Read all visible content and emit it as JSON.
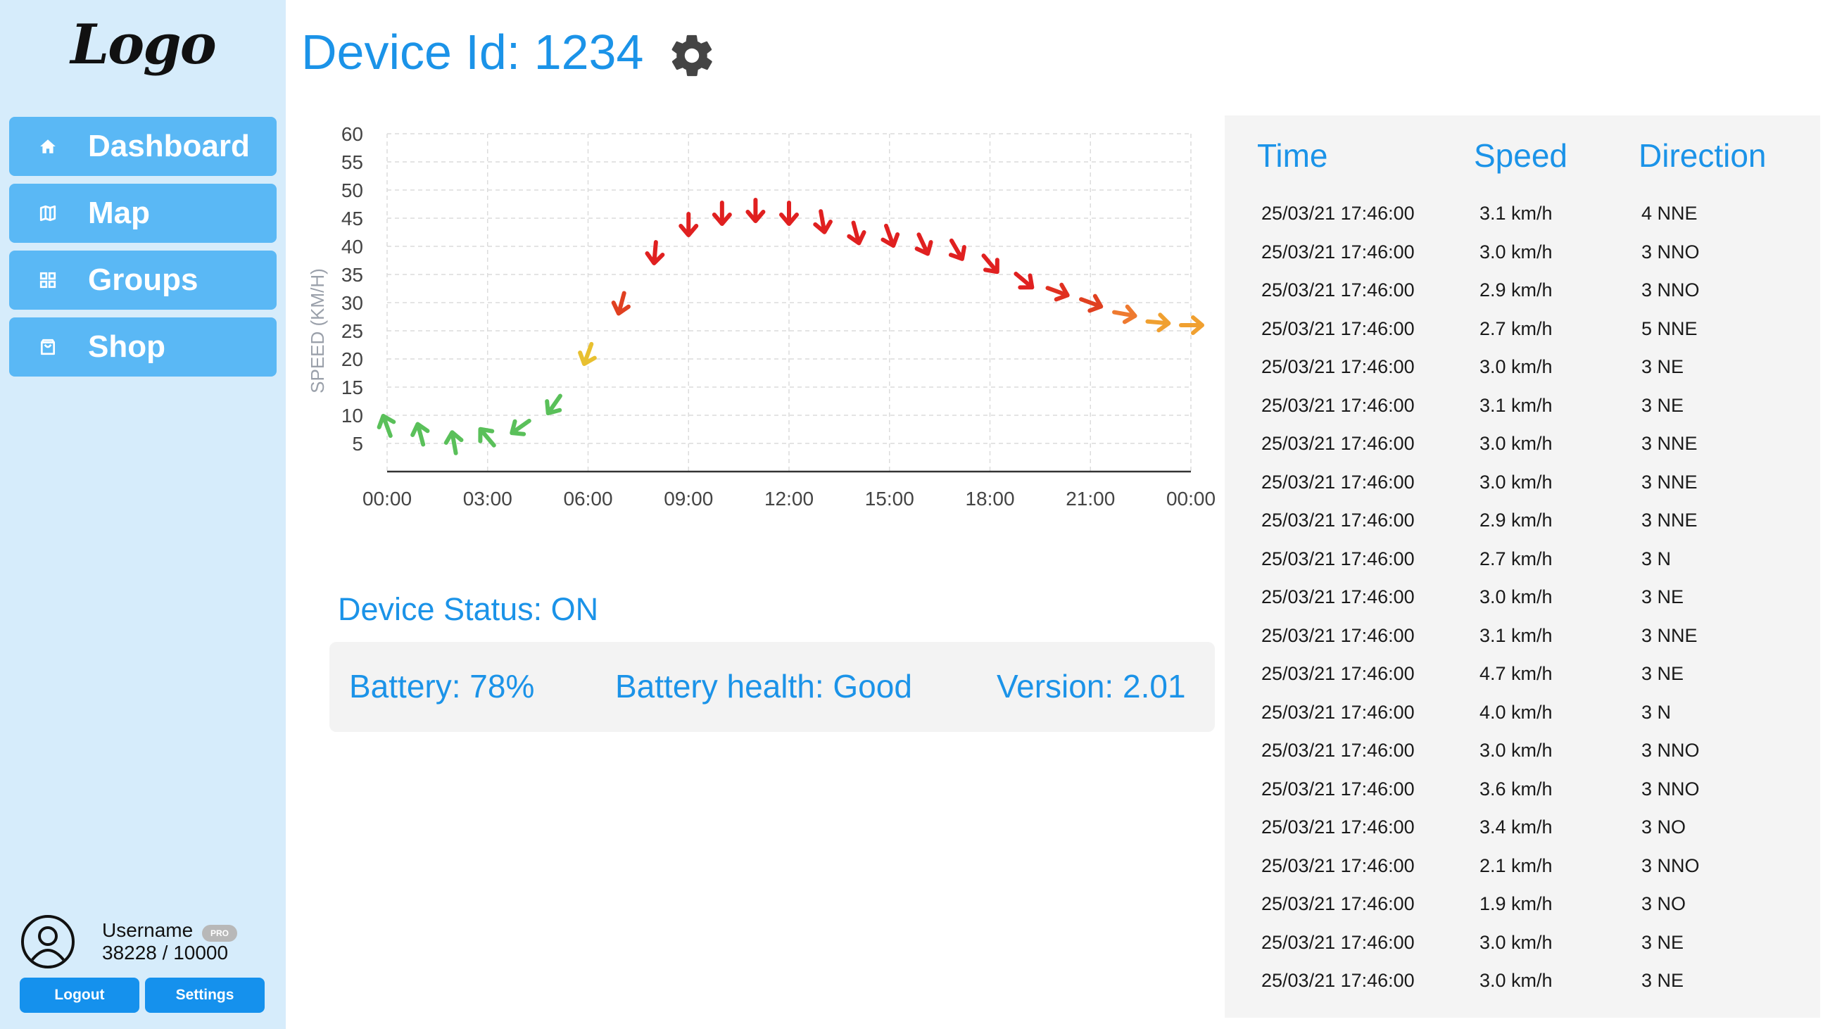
{
  "app": {
    "logo_text": "Logo"
  },
  "sidebar": {
    "items": [
      {
        "label": "Dashboard",
        "icon": "home-icon"
      },
      {
        "label": "Map",
        "icon": "map-icon"
      },
      {
        "label": "Groups",
        "icon": "grid-icon"
      },
      {
        "label": "Shop",
        "icon": "shopping-bag-icon"
      }
    ]
  },
  "user": {
    "name": "Username",
    "badge": "PRO",
    "points": "38228 / 10000",
    "logout_label": "Logout",
    "settings_label": "Settings"
  },
  "header": {
    "title": "Device Id: 1234",
    "settings_icon": "gear-icon"
  },
  "status": {
    "title": "Device Status: ON",
    "battery": "Battery: 78%",
    "battery_health": "Battery health: Good",
    "version": "Version: 2.01"
  },
  "table": {
    "headers": [
      "Time",
      "Speed",
      "Direction"
    ],
    "rows": [
      [
        "25/03/21 17:46:00",
        "3.1 km/h",
        "4 NNE"
      ],
      [
        "25/03/21 17:46:00",
        "3.0 km/h",
        "3 NNO"
      ],
      [
        "25/03/21 17:46:00",
        "2.9 km/h",
        "3 NNO"
      ],
      [
        "25/03/21 17:46:00",
        "2.7 km/h",
        "5 NNE"
      ],
      [
        "25/03/21 17:46:00",
        "3.0 km/h",
        "3 NE"
      ],
      [
        "25/03/21 17:46:00",
        "3.1 km/h",
        "3 NE"
      ],
      [
        "25/03/21 17:46:00",
        "3.0 km/h",
        "3 NNE"
      ],
      [
        "25/03/21 17:46:00",
        "3.0 km/h",
        "3 NNE"
      ],
      [
        "25/03/21 17:46:00",
        "2.9 km/h",
        "3 NNE"
      ],
      [
        "25/03/21 17:46:00",
        "2.7 km/h",
        "3 N"
      ],
      [
        "25/03/21 17:46:00",
        "3.0 km/h",
        "3 NE"
      ],
      [
        "25/03/21 17:46:00",
        "3.1 km/h",
        "3 NNE"
      ],
      [
        "25/03/21 17:46:00",
        "4.7 km/h",
        "3 NE"
      ],
      [
        "25/03/21 17:46:00",
        "4.0 km/h",
        "3 N"
      ],
      [
        "25/03/21 17:46:00",
        "3.0 km/h",
        "3 NNO"
      ],
      [
        "25/03/21 17:46:00",
        "3.6 km/h",
        "3 NNO"
      ],
      [
        "25/03/21 17:46:00",
        "3.4 km/h",
        "3 NO"
      ],
      [
        "25/03/21 17:46:00",
        "2.1 km/h",
        "3 NNO"
      ],
      [
        "25/03/21 17:46:00",
        "1.9 km/h",
        "3 NO"
      ],
      [
        "25/03/21 17:46:00",
        "3.0 km/h",
        "3 NE"
      ],
      [
        "25/03/21 17:46:00",
        "3.0 km/h",
        "3 NE"
      ]
    ]
  },
  "chart_data": {
    "type": "scatter",
    "marker": "wind-direction-arrow",
    "title": "",
    "xlabel": "",
    "ylabel": "SPEED (KM/H)",
    "x_ticks": [
      "00:00",
      "03:00",
      "06:00",
      "09:00",
      "12:00",
      "15:00",
      "18:00",
      "21:00",
      "00:00"
    ],
    "y_ticks": [
      5,
      10,
      15,
      20,
      25,
      30,
      35,
      40,
      45,
      50,
      55,
      60
    ],
    "xlim": [
      0,
      24
    ],
    "ylim": [
      0,
      60
    ],
    "grid": true,
    "colors": {
      "low": "#5ac05a",
      "mid": "#e8c030",
      "high": "#e02020",
      "falling": "#f0a030"
    },
    "points": [
      {
        "x": 0,
        "y": 8,
        "dir_deg": 340,
        "color": "#5ac05a"
      },
      {
        "x": 1,
        "y": 6.5,
        "dir_deg": 345,
        "color": "#5ac05a"
      },
      {
        "x": 2,
        "y": 5,
        "dir_deg": 350,
        "color": "#5ac05a"
      },
      {
        "x": 3,
        "y": 6,
        "dir_deg": 320,
        "color": "#5ac05a"
      },
      {
        "x": 4,
        "y": 8,
        "dir_deg": 235,
        "color": "#5ac05a"
      },
      {
        "x": 5,
        "y": 12,
        "dir_deg": 215,
        "color": "#5ac05a"
      },
      {
        "x": 6,
        "y": 21,
        "dir_deg": 200,
        "color": "#e8c030"
      },
      {
        "x": 7,
        "y": 30,
        "dir_deg": 195,
        "color": "#e04020"
      },
      {
        "x": 8,
        "y": 39,
        "dir_deg": 185,
        "color": "#e02020"
      },
      {
        "x": 9,
        "y": 44,
        "dir_deg": 180,
        "color": "#e02020"
      },
      {
        "x": 10,
        "y": 46,
        "dir_deg": 180,
        "color": "#e02020"
      },
      {
        "x": 11,
        "y": 46.5,
        "dir_deg": 180,
        "color": "#e02020"
      },
      {
        "x": 12,
        "y": 46,
        "dir_deg": 180,
        "color": "#e02020"
      },
      {
        "x": 13,
        "y": 44.5,
        "dir_deg": 170,
        "color": "#e02020"
      },
      {
        "x": 14,
        "y": 42.5,
        "dir_deg": 165,
        "color": "#e02020"
      },
      {
        "x": 15,
        "y": 42,
        "dir_deg": 160,
        "color": "#e02020"
      },
      {
        "x": 16,
        "y": 40.5,
        "dir_deg": 155,
        "color": "#e02020"
      },
      {
        "x": 17,
        "y": 39.5,
        "dir_deg": 150,
        "color": "#e02020"
      },
      {
        "x": 18,
        "y": 37,
        "dir_deg": 140,
        "color": "#e02020"
      },
      {
        "x": 19,
        "y": 34,
        "dir_deg": 130,
        "color": "#e02020"
      },
      {
        "x": 20,
        "y": 32,
        "dir_deg": 110,
        "color": "#e03020"
      },
      {
        "x": 21,
        "y": 30,
        "dir_deg": 110,
        "color": "#e04020"
      },
      {
        "x": 22,
        "y": 28,
        "dir_deg": 100,
        "color": "#ee7a30"
      },
      {
        "x": 23,
        "y": 26.5,
        "dir_deg": 95,
        "color": "#f0a030"
      },
      {
        "x": 24,
        "y": 26,
        "dir_deg": 90,
        "color": "#f0a030"
      }
    ]
  }
}
